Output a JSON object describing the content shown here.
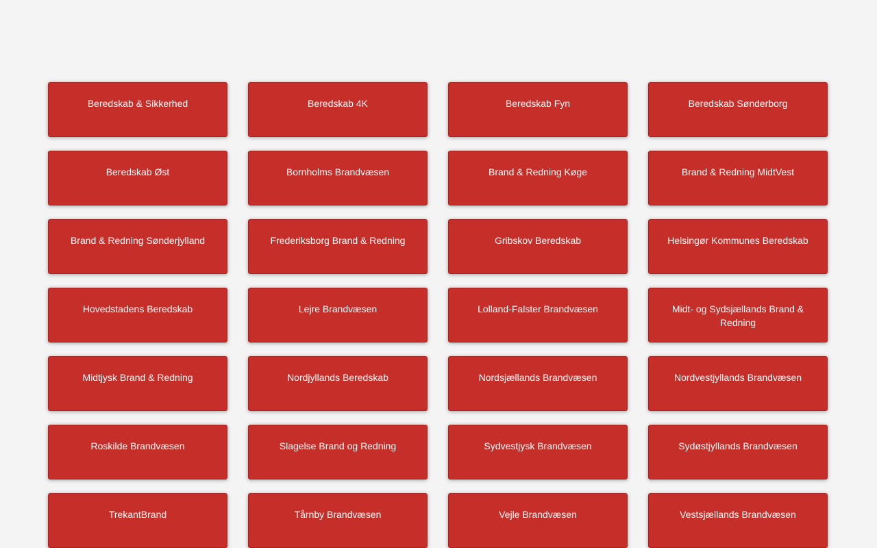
{
  "tiles": [
    "Beredskab & Sikkerhed",
    "Beredskab 4K",
    "Beredskab Fyn",
    "Beredskab Sønderborg",
    "Beredskab Øst",
    "Bornholms Brandvæsen",
    "Brand & Redning Køge",
    "Brand & Redning MidtVest",
    "Brand & Redning Sønderjylland",
    "Frederiksborg Brand & Redning",
    "Gribskov Beredskab",
    "Helsingør Kommunes Beredskab",
    "Hovedstadens Beredskab",
    "Lejre Brandvæsen",
    "Lolland-Falster Brandvæsen",
    "Midt- og Sydsjællands Brand & Redning",
    "Midtjysk Brand & Redning",
    "Nordjyllands Beredskab",
    "Nordsjællands Brandvæsen",
    "Nordvestjyllands Brandvæsen",
    "Roskilde Brandvæsen",
    "Slagelse Brand og Redning",
    "Sydvestjysk Brandvæsen",
    "Sydøstjyllands Brandvæsen",
    "TrekantBrand",
    "Tårnby Brandvæsen",
    "Vejle Brandvæsen",
    "Vestsjællands Brandvæsen"
  ],
  "colors": {
    "background": "#f4f4f4",
    "tile": "#c62e2a",
    "tile_text": "#ffffff"
  }
}
